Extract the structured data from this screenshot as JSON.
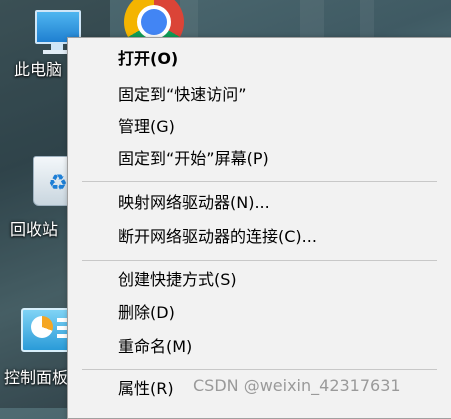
{
  "desktop": {
    "icons": [
      {
        "label": "此电脑",
        "icon": "this-pc-icon"
      },
      {
        "label": "",
        "icon": "chrome-icon"
      },
      {
        "label": "回收站",
        "icon": "recycle-bin-icon"
      },
      {
        "label": "控制面板",
        "icon": "control-panel-icon"
      }
    ]
  },
  "context_menu": {
    "items": [
      {
        "label": "打开(O)",
        "bold": true
      },
      {
        "label": "固定到“快速访问”"
      },
      {
        "label": "管理(G)"
      },
      {
        "label": "固定到“开始”屏幕(P)"
      },
      {
        "label": "映射网络驱动器(N)..."
      },
      {
        "label": "断开网络驱动器的连接(C)..."
      },
      {
        "label": "创建快捷方式(S)"
      },
      {
        "label": "删除(D)"
      },
      {
        "label": "重命名(M)"
      },
      {
        "label": "属性(R)"
      }
    ]
  },
  "watermark": "CSDN @weixin_42317631"
}
